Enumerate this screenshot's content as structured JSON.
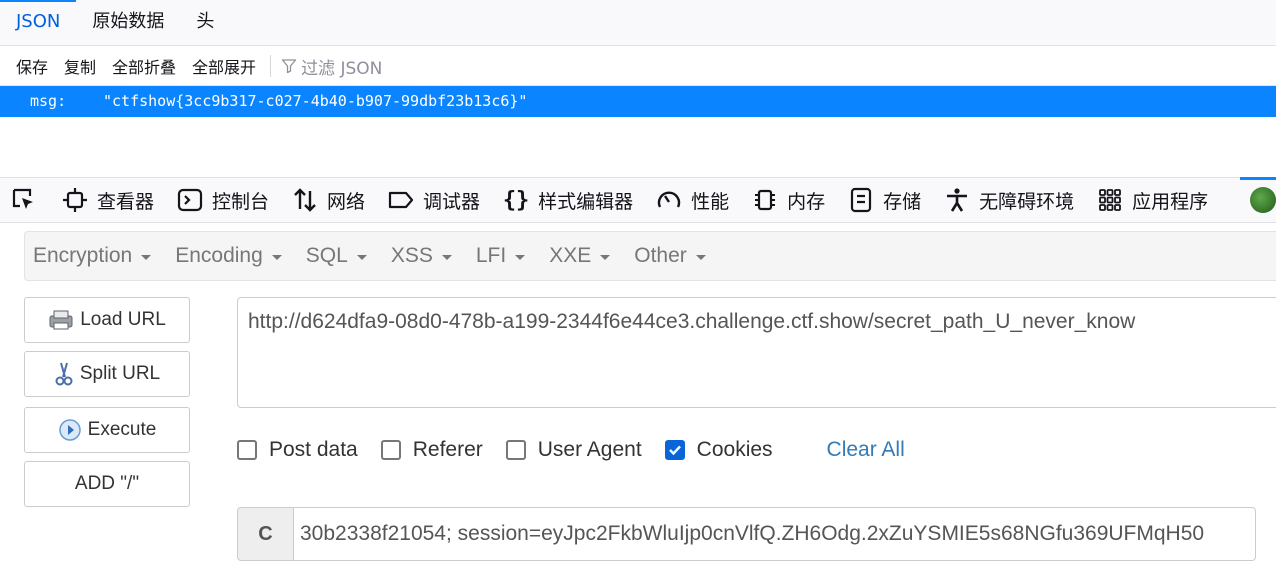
{
  "json_viewer": {
    "tabs": [
      {
        "label": "JSON",
        "active": true
      },
      {
        "label": "原始数据",
        "active": false
      },
      {
        "label": "头",
        "active": false
      }
    ],
    "toolbar": {
      "save": "保存",
      "copy": "复制",
      "collapse_all": "全部折叠",
      "expand_all": "全部展开",
      "filter_placeholder": "过滤 JSON"
    },
    "rows": [
      {
        "key": "msg:",
        "value": "\"ctfshow{3cc9b317-c027-4b40-b907-99dbf23b13c6}\""
      }
    ]
  },
  "devtools": {
    "tabs": [
      {
        "label": "查看器",
        "icon": "inspector-icon"
      },
      {
        "label": "控制台",
        "icon": "console-icon"
      },
      {
        "label": "网络",
        "icon": "network-icon"
      },
      {
        "label": "调试器",
        "icon": "debugger-icon"
      },
      {
        "label": "样式编辑器",
        "icon": "style-editor-icon"
      },
      {
        "label": "性能",
        "icon": "performance-icon"
      },
      {
        "label": "内存",
        "icon": "memory-icon"
      },
      {
        "label": "存储",
        "icon": "storage-icon"
      },
      {
        "label": "无障碍环境",
        "icon": "accessibility-icon"
      },
      {
        "label": "应用程序",
        "icon": "application-icon"
      }
    ]
  },
  "hackbar": {
    "menu": [
      "Encryption",
      "Encoding",
      "SQL",
      "XSS",
      "LFI",
      "XXE",
      "Other"
    ],
    "buttons": {
      "load_url": "Load URL",
      "split_url": "Split URL",
      "execute": "Execute",
      "add_slash": "ADD \"/\""
    },
    "url": "http://d624dfa9-08d0-478b-a199-2344f6e44ce3.challenge.ctf.show/secret_path_U_never_know",
    "options": [
      {
        "label": "Post data",
        "checked": false
      },
      {
        "label": "Referer",
        "checked": false
      },
      {
        "label": "User Agent",
        "checked": false
      },
      {
        "label": "Cookies",
        "checked": true
      }
    ],
    "clear_all": "Clear All",
    "cookie_prefix": "C",
    "cookie_value": "30b2338f21054; session=eyJpc2FkbWluIjp0cnVlfQ.ZH6Odg.2xZuYSMIE5s68NGfu369UFMqH50"
  },
  "colors": {
    "accent": "#0a84ff",
    "link": "#337ab7",
    "checkbox_checked": "#0a66d8"
  }
}
